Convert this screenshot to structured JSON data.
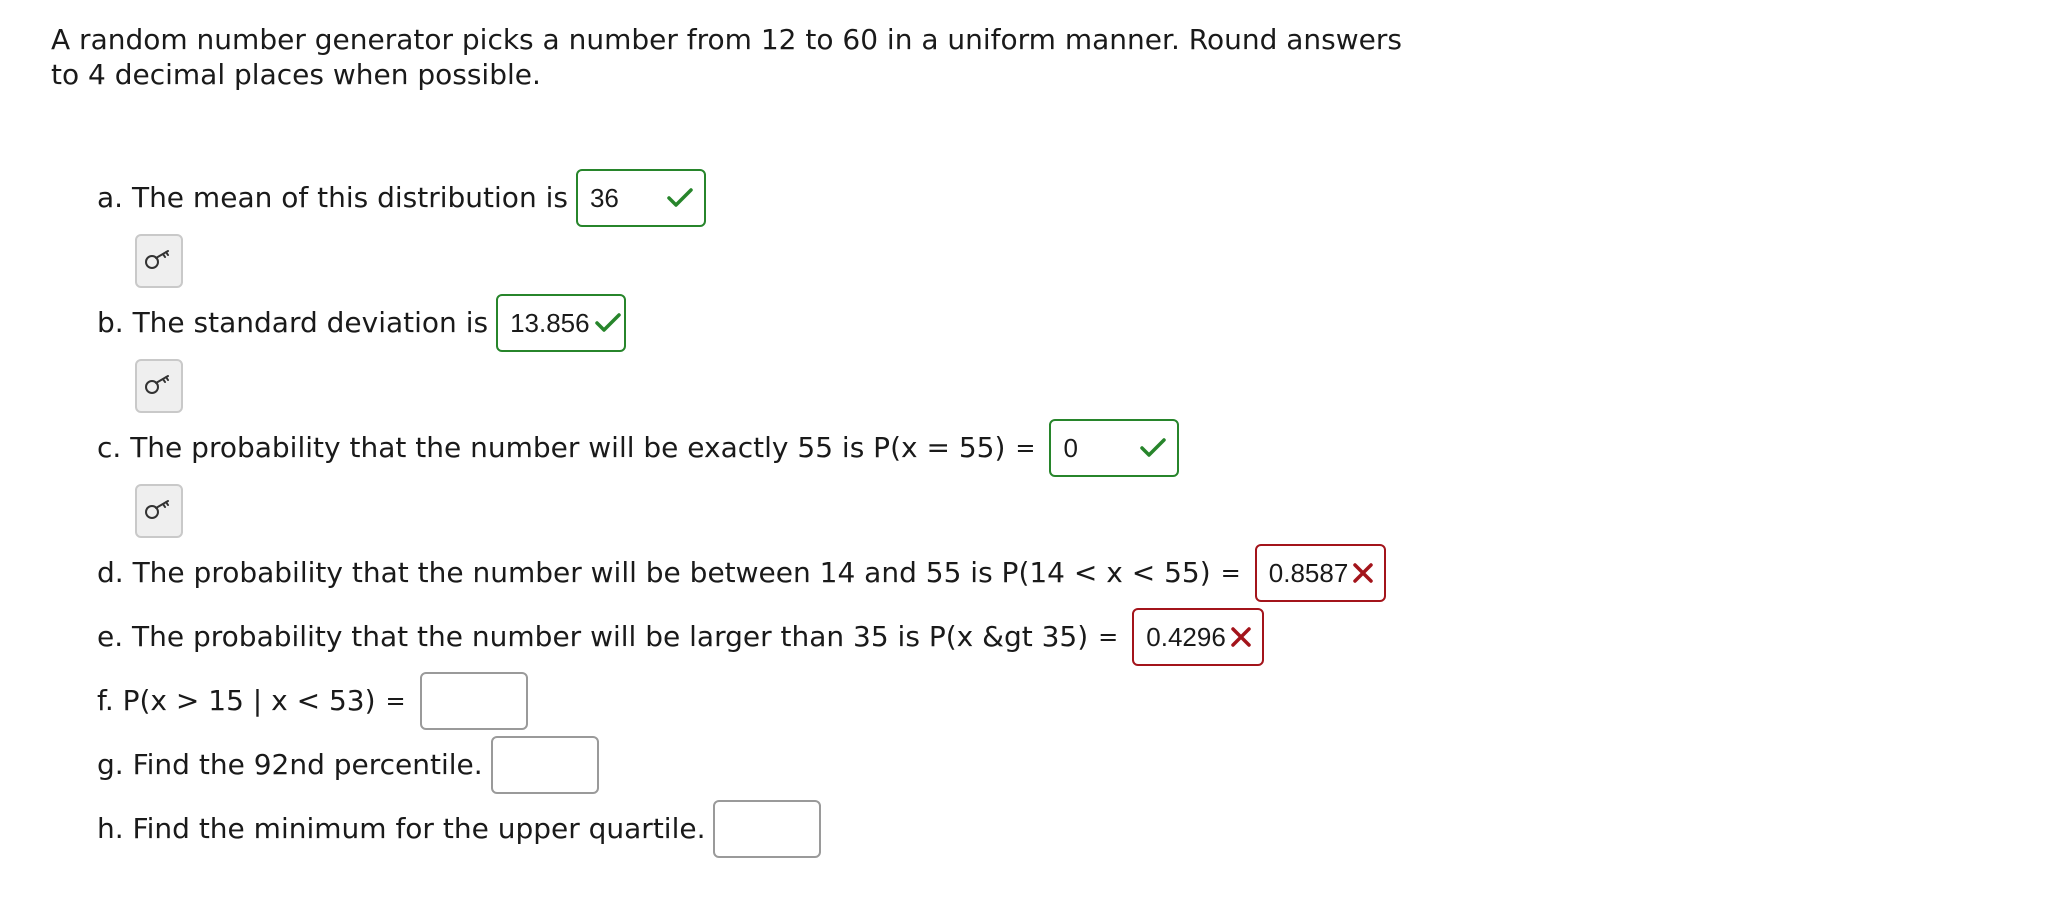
{
  "intro": "A random number generator picks a number from 12 to 60 in a uniform manner. Round answers to 4 decimal places when possible.",
  "questions": {
    "a": {
      "label": "a. The mean of this distribution is",
      "answer": "36",
      "status": "correct"
    },
    "b": {
      "label": "b. The standard deviation is",
      "answer": "13.856",
      "status": "correct"
    },
    "c": {
      "label": "c. The probability that the number will be exactly 55 is P(x = 55)",
      "eq": "=",
      "answer": "0",
      "status": "correct"
    },
    "d": {
      "label": "d. The probability that the number will be between 14 and 55 is P(14 < x < 55)",
      "eq": "=",
      "answer": "0.8587",
      "status": "incorrect"
    },
    "e": {
      "label": "e. The probability that the number will be larger than 35 is P(x &gt 35)",
      "eq": "=",
      "answer": "0.4296",
      "status": "incorrect"
    },
    "f": {
      "label": "f. P(x > 15 | x < 53)",
      "eq": "=",
      "answer": ""
    },
    "g": {
      "label": "g. Find the 92nd percentile.",
      "answer": ""
    },
    "h": {
      "label": "h. Find the minimum for the upper quartile.",
      "answer": ""
    }
  },
  "icons": {
    "correct": "checkmark-icon",
    "incorrect": "x-mark-icon",
    "hint": "key-icon"
  },
  "colors": {
    "correct": "#27852b",
    "incorrect": "#a3141b",
    "blank_border": "#9a9a9a",
    "hint_bg": "#efefef"
  }
}
